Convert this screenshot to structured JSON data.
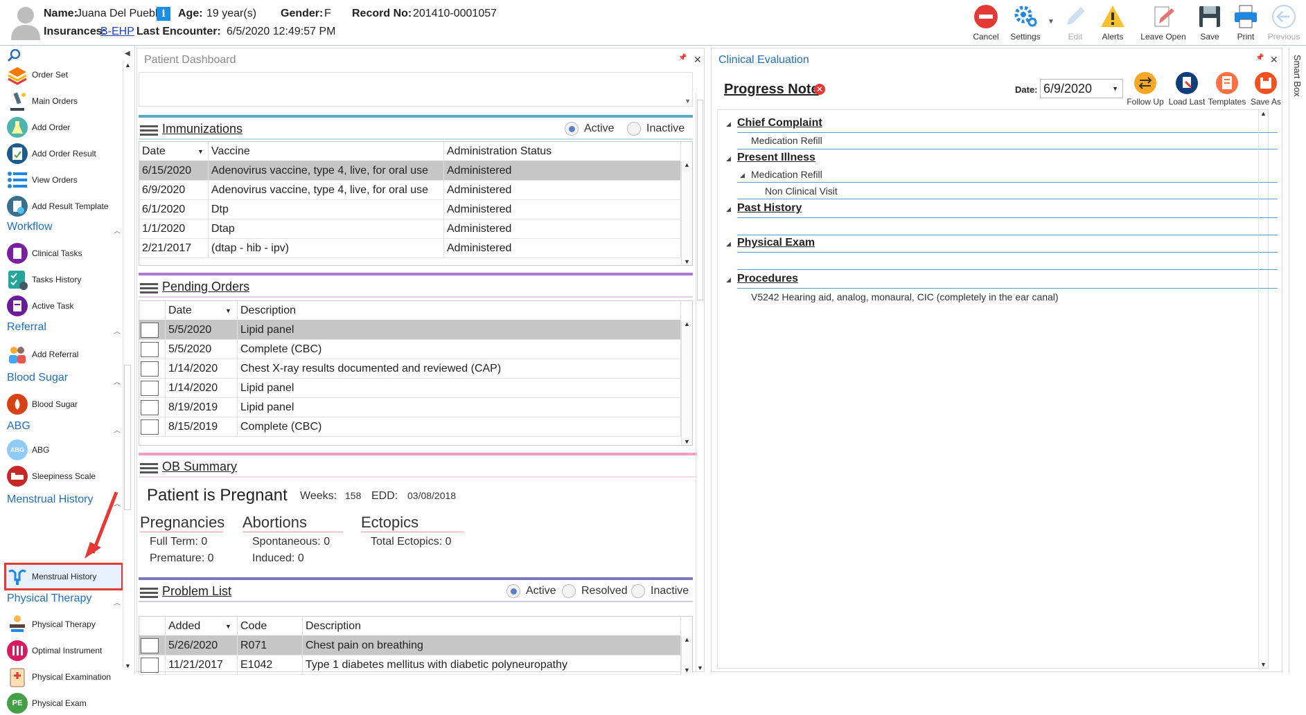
{
  "header": {
    "name_label": "Name:",
    "name": "Juana Del Pueblo",
    "age_label": "Age:",
    "age": "19 year(s)",
    "gender_label": "Gender:",
    "gender": "F",
    "record_label": "Record No:",
    "record": "201410-0001057",
    "insurances_label": "Insurances:",
    "insurance": "B-EHP",
    "last_encounter_label": "Last Encounter:",
    "last_encounter": "6/5/2020 12:49:57 PM",
    "toolbar": {
      "cancel": "Cancel",
      "settings": "Settings",
      "edit": "Edit",
      "alerts": "Alerts",
      "leave_open": "Leave Open",
      "save": "Save",
      "print": "Print",
      "previous": "Previous"
    }
  },
  "sidebar": {
    "orders": [
      {
        "label": "Order Set",
        "icon": "layers-icon"
      },
      {
        "label": "Main Orders",
        "icon": "microscope-icon"
      },
      {
        "label": "Add Order",
        "icon": "flask-icon"
      },
      {
        "label": "Add Order Result",
        "icon": "clipboard-icon"
      },
      {
        "label": "View Orders",
        "icon": "list-icon"
      },
      {
        "label": "Add Result Template",
        "icon": "template-icon"
      }
    ],
    "workflow_header": "Workflow",
    "workflow": [
      {
        "label": "Clinical Tasks",
        "icon": "tasks-icon"
      },
      {
        "label": "Tasks History",
        "icon": "checklist-icon"
      },
      {
        "label": "Active Task",
        "icon": "active-task-icon"
      }
    ],
    "referral_header": "Referral",
    "referral": [
      {
        "label": "Add Referral",
        "icon": "people-icon"
      }
    ],
    "blood_sugar_header": "Blood Sugar",
    "blood_sugar": [
      {
        "label": "Blood Sugar",
        "icon": "drop-icon"
      }
    ],
    "abg_header": "ABG",
    "abg": [
      {
        "label": "ABG",
        "icon": "abg-icon"
      },
      {
        "label": "Sleepiness Scale",
        "icon": "bed-icon"
      }
    ],
    "menstrual_header": "Menstrual History",
    "menstrual": [
      {
        "label": "Menstrual History",
        "icon": "uterus-icon"
      }
    ],
    "pt_header": "Physical Therapy",
    "pt": [
      {
        "label": "Physical Therapy",
        "icon": "therapy-icon"
      },
      {
        "label": "Optimal Instrument",
        "icon": "instrument-icon"
      },
      {
        "label": "Physical Examination",
        "icon": "exam-icon"
      },
      {
        "label": "Physical Exam",
        "icon": "pe-icon",
        "badge": "PE"
      }
    ],
    "abg_badge": "ABG"
  },
  "dashboard": {
    "title": "Patient Dashboard",
    "pin": "📌",
    "close": "✕",
    "immunizations": {
      "title": "Immunizations",
      "active": "Active",
      "inactive": "Inactive",
      "columns": [
        "Date",
        "Vaccine",
        "Administration Status"
      ],
      "rows": [
        [
          "6/15/2020",
          "Adenovirus vaccine, type 4, live, for oral use",
          "Administered"
        ],
        [
          "6/9/2020",
          "Adenovirus vaccine, type 4, live, for oral use",
          "Administered"
        ],
        [
          "6/1/2020",
          "Dtp",
          "Administered"
        ],
        [
          "1/1/2020",
          "Dtap",
          "Administered"
        ],
        [
          "2/21/2017",
          "(dtap - hib - ipv)",
          "Administered"
        ]
      ]
    },
    "pending_orders": {
      "title": "Pending Orders",
      "columns": [
        "Date",
        "Description"
      ],
      "rows": [
        [
          "5/5/2020",
          "Lipid panel"
        ],
        [
          "5/5/2020",
          "Complete (CBC)"
        ],
        [
          "1/14/2020",
          "Chest X-ray results documented and reviewed (CAP)"
        ],
        [
          "1/14/2020",
          "Lipid panel"
        ],
        [
          "8/19/2019",
          "Lipid panel"
        ],
        [
          "8/15/2019",
          "Complete (CBC)"
        ]
      ]
    },
    "ob_summary": {
      "title": "OB Summary",
      "pregnant": "Patient is Pregnant",
      "weeks_label": "Weeks:",
      "weeks": "158",
      "edd_label": "EDD:",
      "edd": "03/08/2018",
      "pregnancies": "Pregnancies",
      "full_term": "Full Term: 0",
      "premature": "Premature: 0",
      "abortions": "Abortions",
      "spontaneous": "Spontaneous: 0",
      "induced": "Induced: 0",
      "ectopics": "Ectopics",
      "total_ectopics": "Total Ectopics: 0"
    },
    "problem_list": {
      "title": "Problem List",
      "active": "Active",
      "resolved": "Resolved",
      "inactive": "Inactive",
      "columns": [
        "Added",
        "Code",
        "Description"
      ],
      "rows": [
        [
          "5/26/2020",
          "R071",
          "Chest pain on breathing"
        ],
        [
          "11/21/2017",
          "E1042",
          "Type 1 diabetes mellitus with diabetic polyneuropathy"
        ]
      ]
    }
  },
  "clinical": {
    "title": "Clinical Evaluation",
    "note_title": "Progress Note",
    "date_label": "Date:",
    "date": "6/9/2020",
    "toolbar": {
      "follow_up": "Follow Up",
      "load_last": "Load Last",
      "templates": "Templates",
      "save_as": "Save As"
    },
    "sections": {
      "chief_complaint": "Chief Complaint",
      "cc_item": "Medication Refill",
      "present_illness": "Present Illness",
      "pi_item": "Medication Refill",
      "pi_sub": "Non Clinical Visit",
      "past_history": "Past History",
      "physical_exam": "Physical Exam",
      "procedures": "Procedures",
      "proc_item": "V5242 Hearing aid, analog, monaural, CIC (completely in the ear canal)"
    },
    "smart_box": "Smart Box"
  },
  "colors": {
    "accent_blue": "#1e6fc2",
    "immunizations_bar": "#5fa8c8",
    "pending_bar": "#a97ad0",
    "ob_bar": "#f29cc4",
    "problem_bar": "#7b76c0",
    "highlight": "#e53935"
  }
}
